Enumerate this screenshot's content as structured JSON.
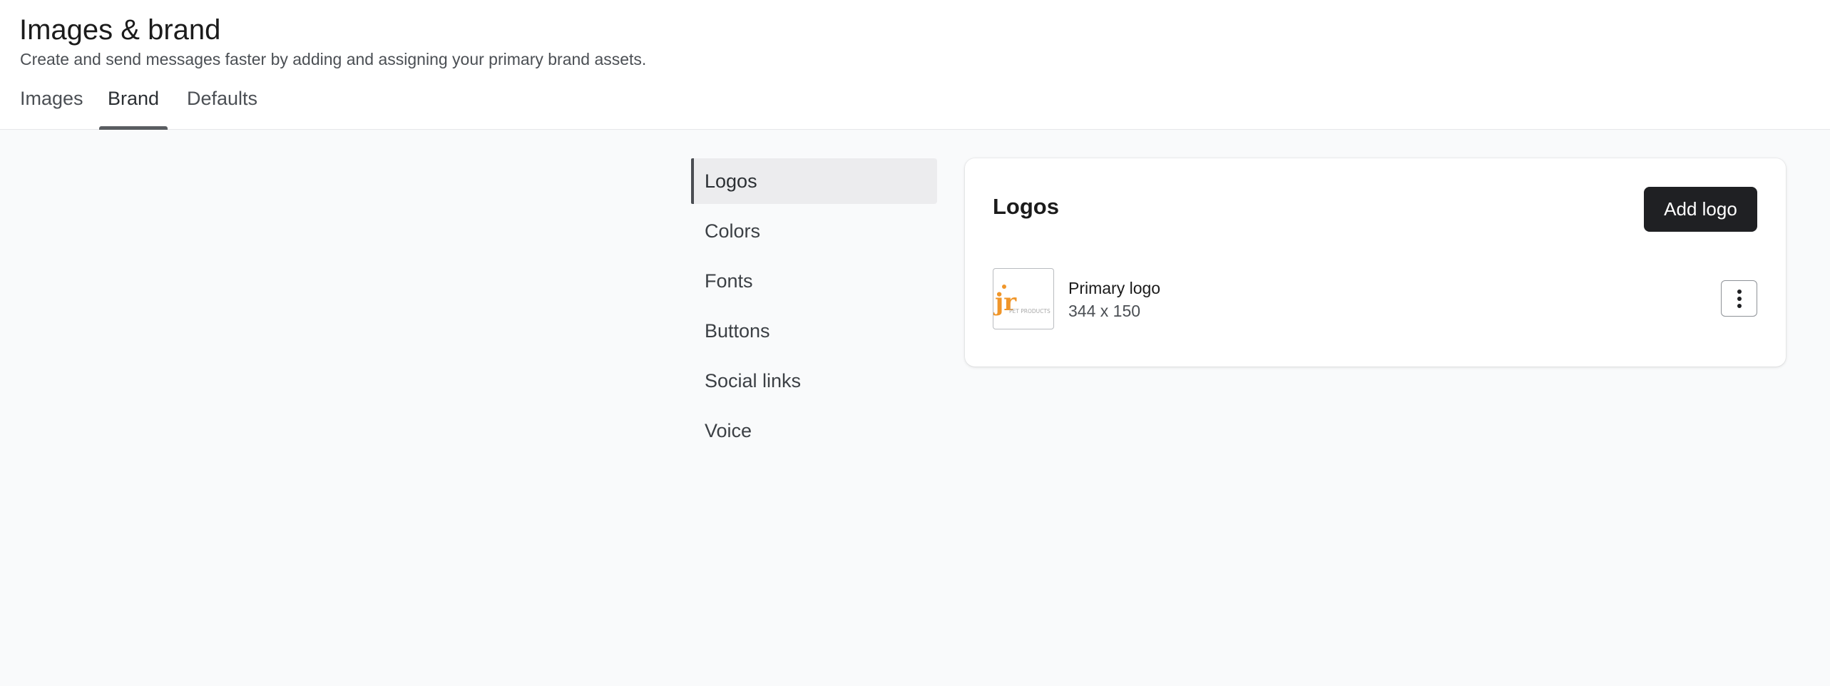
{
  "header": {
    "title": "Images & brand",
    "subtitle": "Create and send messages faster by adding and assigning your primary brand assets."
  },
  "tabs": [
    {
      "label": "Images",
      "active": false
    },
    {
      "label": "Brand",
      "active": true
    },
    {
      "label": "Defaults",
      "active": false
    }
  ],
  "sidenav": {
    "items": [
      {
        "label": "Logos",
        "active": true
      },
      {
        "label": "Colors",
        "active": false
      },
      {
        "label": "Fonts",
        "active": false
      },
      {
        "label": "Buttons",
        "active": false
      },
      {
        "label": "Social links",
        "active": false
      },
      {
        "label": "Voice",
        "active": false
      }
    ]
  },
  "card": {
    "title": "Logos",
    "add_label": "Add logo",
    "logos": [
      {
        "name": "Primary logo",
        "dimensions": "344 x 150",
        "thumb_mark": "jr",
        "thumb_caption": "PET PRODUCTS",
        "more_icon": "more-vertical-icon"
      }
    ]
  },
  "colors": {
    "accent_dark": "#1f2023",
    "logo_orange": "#f0962a",
    "tab_underline": "#5a5d61"
  }
}
